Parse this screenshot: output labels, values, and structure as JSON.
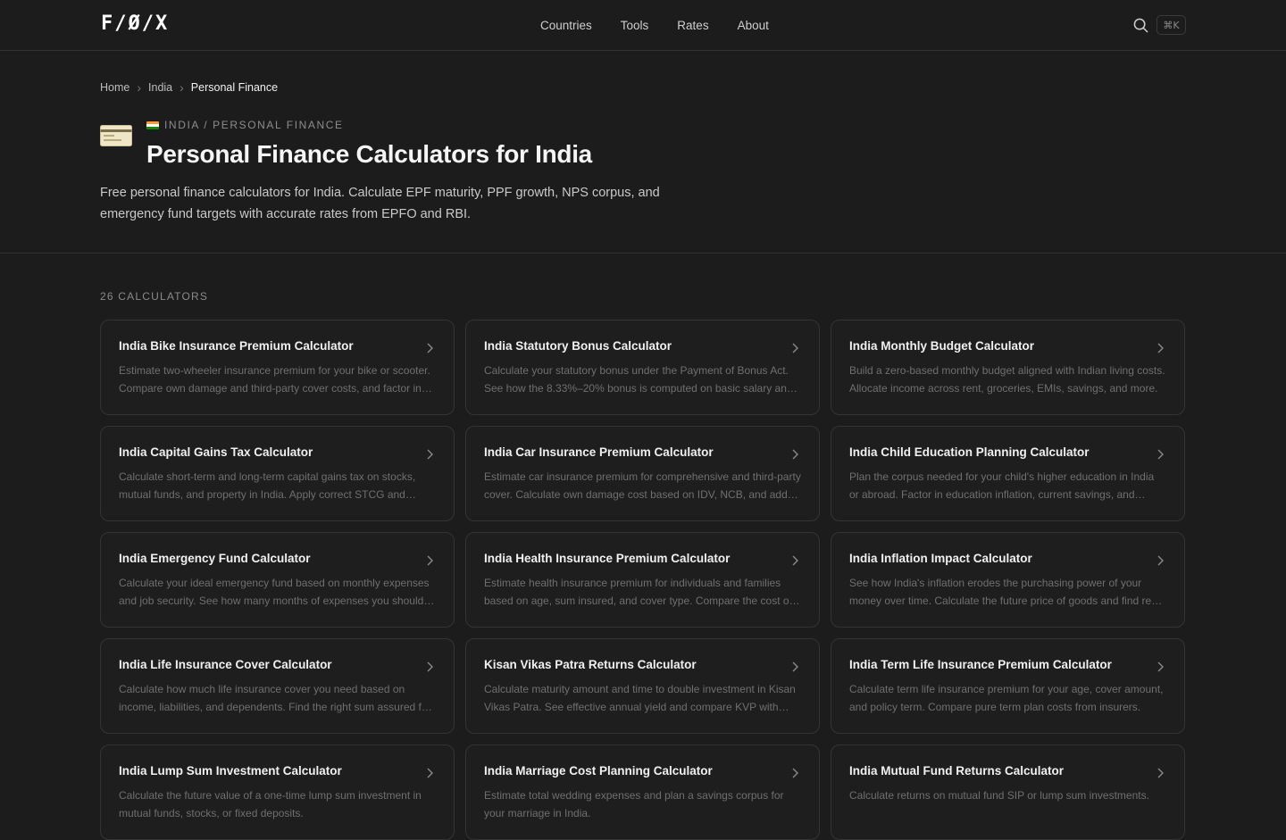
{
  "header": {
    "logo": "F/Ø/X",
    "nav": [
      "Countries",
      "Tools",
      "Rates",
      "About"
    ],
    "shortcut": "⌘K"
  },
  "breadcrumb": [
    "Home",
    "India",
    "Personal Finance"
  ],
  "hero": {
    "eyebrow": "INDIA / PERSONAL FINANCE",
    "title": "Personal Finance Calculators for India",
    "description": "Free personal finance calculators for India. Calculate EPF maturity, PPF growth, NPS corpus, and emergency fund targets with accurate rates from EPFO and RBI."
  },
  "count_label": "26 CALCULATORS",
  "calculators": [
    {
      "title": "India Bike Insurance Premium Calculator",
      "desc": "Estimate two-wheeler insurance premium for your bike or scooter. Compare own damage and third-party cover costs, and factor in NCB discounts."
    },
    {
      "title": "India Statutory Bonus Calculator",
      "desc": "Calculate your statutory bonus under the Payment of Bonus Act. See how the 8.33%–20% bonus is computed on basic salary and wage ceilings."
    },
    {
      "title": "India Monthly Budget Calculator",
      "desc": "Build a zero-based monthly budget aligned with Indian living costs. Allocate income across rent, groceries, EMIs, savings, and more."
    },
    {
      "title": "India Capital Gains Tax Calculator",
      "desc": "Calculate short-term and long-term capital gains tax on stocks, mutual funds, and property in India. Apply correct STCG and LTCG rates."
    },
    {
      "title": "India Car Insurance Premium Calculator",
      "desc": "Estimate car insurance premium for comprehensive and third-party cover. Calculate own damage cost based on IDV, NCB, and add-ons."
    },
    {
      "title": "India Child Education Planning Calculator",
      "desc": "Plan the corpus needed for your child's higher education in India or abroad. Factor in education inflation, current savings, and returns."
    },
    {
      "title": "India Emergency Fund Calculator",
      "desc": "Calculate your ideal emergency fund based on monthly expenses and job security. See how many months of expenses you should save."
    },
    {
      "title": "India Health Insurance Premium Calculator",
      "desc": "Estimate health insurance premium for individuals and families based on age, sum insured, and cover type. Compare the cost of plans."
    },
    {
      "title": "India Inflation Impact Calculator",
      "desc": "See how India's inflation erodes the purchasing power of your money over time. Calculate the future price of goods and find real returns."
    },
    {
      "title": "India Life Insurance Cover Calculator",
      "desc": "Calculate how much life insurance cover you need based on income, liabilities, and dependents. Find the right sum assured for your family."
    },
    {
      "title": "Kisan Vikas Patra Returns Calculator",
      "desc": "Calculate maturity amount and time to double investment in Kisan Vikas Patra. See effective annual yield and compare KVP with FDs."
    },
    {
      "title": "India Term Life Insurance Premium Calculator",
      "desc": "Calculate term life insurance premium for your age, cover amount, and policy term. Compare pure term plan costs from insurers."
    },
    {
      "title": "India Lump Sum Investment Calculator",
      "desc": "Calculate the future value of a one-time lump sum investment in mutual funds, stocks, or fixed deposits."
    },
    {
      "title": "India Marriage Cost Planning Calculator",
      "desc": "Estimate total wedding expenses and plan a savings corpus for your marriage in India."
    },
    {
      "title": "India Mutual Fund Returns Calculator",
      "desc": "Calculate returns on mutual fund SIP or lump sum investments."
    }
  ]
}
